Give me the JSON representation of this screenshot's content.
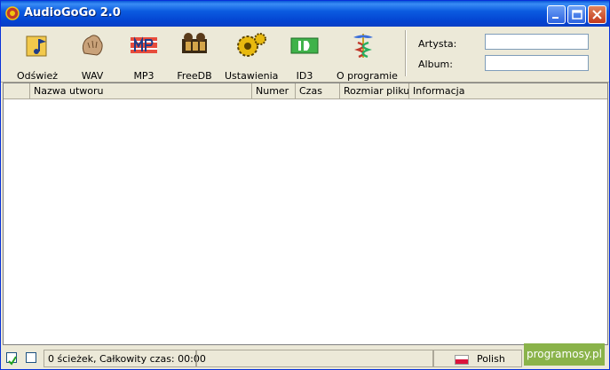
{
  "window": {
    "title": "AudioGoGo 2.0"
  },
  "toolbar": {
    "buttons": [
      {
        "label": "Odśwież",
        "icon": "refresh-music-icon"
      },
      {
        "label": "WAV",
        "icon": "wav-hand-icon"
      },
      {
        "label": "MP3",
        "icon": "mp3-icon"
      },
      {
        "label": "FreeDB",
        "icon": "film-reel-icon"
      },
      {
        "label": "Ustawienia",
        "icon": "gears-icon"
      },
      {
        "label": "ID3",
        "icon": "id3-icon"
      },
      {
        "label": "O programie",
        "icon": "caduceus-icon"
      }
    ],
    "artist_label": "Artysta:",
    "album_label": "Album:",
    "artist_value": "",
    "album_value": ""
  },
  "list": {
    "columns": [
      "Nazwa utworu",
      "Numer",
      "Czas",
      "Rozmiar pliku",
      "Informacja"
    ],
    "rows": []
  },
  "status": {
    "text": "0 ścieżek,  Całkowity czas: 00:00",
    "language": "Polish",
    "check_all": true,
    "check_none": false
  },
  "watermark": "programosy.pl",
  "colors": {
    "title_bar": "#0a59d8",
    "window_bg": "#ece9d8",
    "watermark_bg": "#8ab34a"
  }
}
